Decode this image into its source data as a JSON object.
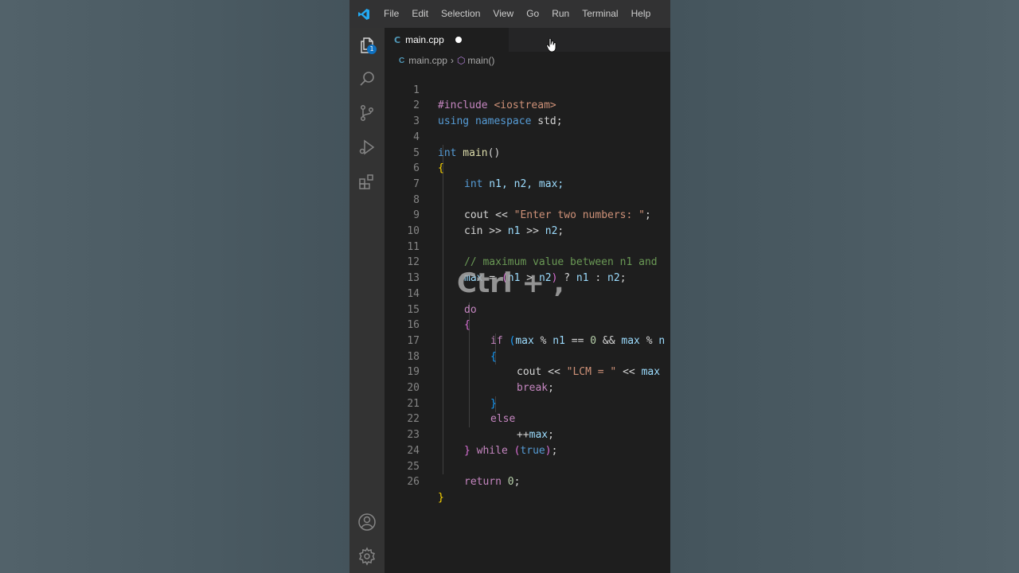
{
  "menu": [
    "File",
    "Edit",
    "Selection",
    "View",
    "Go",
    "Run",
    "Terminal",
    "Help"
  ],
  "tab": {
    "label": "main.cpp",
    "icon": "C"
  },
  "breadcrumb": {
    "file": "main.cpp",
    "symbol": "main()"
  },
  "explorer_badge": "1",
  "overlay_text": "Ctrl + ,",
  "line_numbers": [
    "1",
    "2",
    "3",
    "4",
    "5",
    "6",
    "7",
    "8",
    "9",
    "10",
    "11",
    "12",
    "13",
    "14",
    "15",
    "16",
    "17",
    "18",
    "19",
    "20",
    "21",
    "22",
    "23",
    "24",
    "25",
    "26"
  ],
  "code": {
    "l1": {
      "a": "#include ",
      "b": "<iostream>"
    },
    "l2": {
      "a": "using",
      "b": " namespace",
      "c": " std;"
    },
    "l4": {
      "a": "int",
      "b": " main",
      "c": "()"
    },
    "l5": {
      "a": "{"
    },
    "l6": {
      "a": "int",
      "b": " n1, n2, max;"
    },
    "l8": {
      "a": "cout",
      "b": " << ",
      "c": "\"Enter two numbers: \"",
      "d": ";"
    },
    "l9": {
      "a": "cin",
      "b": " >> ",
      "c": "n1",
      "d": " >> ",
      "e": "n2",
      "f": ";"
    },
    "l11": {
      "a": "// maximum value between n1 and"
    },
    "l12": {
      "a": "max",
      "b": " = ",
      "c": "(",
      "d": "n1",
      "e": " > ",
      "f": "n2",
      "g": ")",
      "h": " ? ",
      "i": "n1",
      "j": " : ",
      "k": "n2",
      "l": ";"
    },
    "l14": {
      "a": "do"
    },
    "l15": {
      "a": "{"
    },
    "l16": {
      "a": "if",
      "b": " (",
      "c": "max",
      "d": " % ",
      "e": "n1",
      "f": " == ",
      "g": "0",
      "h": " && ",
      "i": "max",
      "j": " % ",
      "k": "n"
    },
    "l17": {
      "a": "{"
    },
    "l18": {
      "a": "cout",
      "b": " << ",
      "c": "\"LCM = \"",
      "d": " << ",
      "e": "max"
    },
    "l19": {
      "a": "break",
      "b": ";"
    },
    "l20": {
      "a": "}"
    },
    "l21": {
      "a": "else"
    },
    "l22": {
      "a": "++",
      "b": "max",
      "c": ";"
    },
    "l23": {
      "a": "}",
      "b": " while",
      "c": " (",
      "d": "true",
      "e": ")",
      "f": ";"
    },
    "l25": {
      "a": "return",
      "b": " 0",
      "c": ";"
    },
    "l26": {
      "a": "}"
    }
  }
}
